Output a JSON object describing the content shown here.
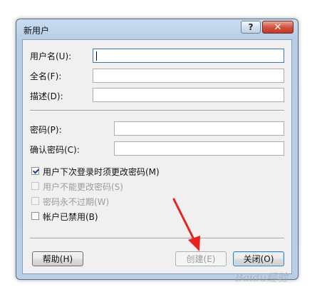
{
  "dialog": {
    "title": "新用户",
    "help_glyph": "?",
    "close_glyph": "✕"
  },
  "fields": {
    "username_label": "用户名(U):",
    "fullname_label": "全名(F):",
    "description_label": "描述(D):",
    "password_label": "密码(P):",
    "confirm_label": "确认密码(C):",
    "username_value": "",
    "fullname_value": "",
    "description_value": "",
    "password_value": "",
    "confirm_value": ""
  },
  "options": {
    "must_change": {
      "label": "用户下次登录时须更改密码(M)",
      "checked": true,
      "enabled": true
    },
    "cannot_change": {
      "label": "用户不能更改密码(S)",
      "checked": false,
      "enabled": false
    },
    "never_expires": {
      "label": "密码永不过期(W)",
      "checked": false,
      "enabled": false
    },
    "disabled_account": {
      "label": "帐户已禁用(B)",
      "checked": false,
      "enabled": true
    }
  },
  "buttons": {
    "help_label": "帮助(H)",
    "create_label": "创建(E)",
    "close_label": "关闭(O)"
  },
  "annotation": {
    "arrow_color": "#e8231f"
  },
  "watermark": {
    "text": "Baidu经验"
  }
}
